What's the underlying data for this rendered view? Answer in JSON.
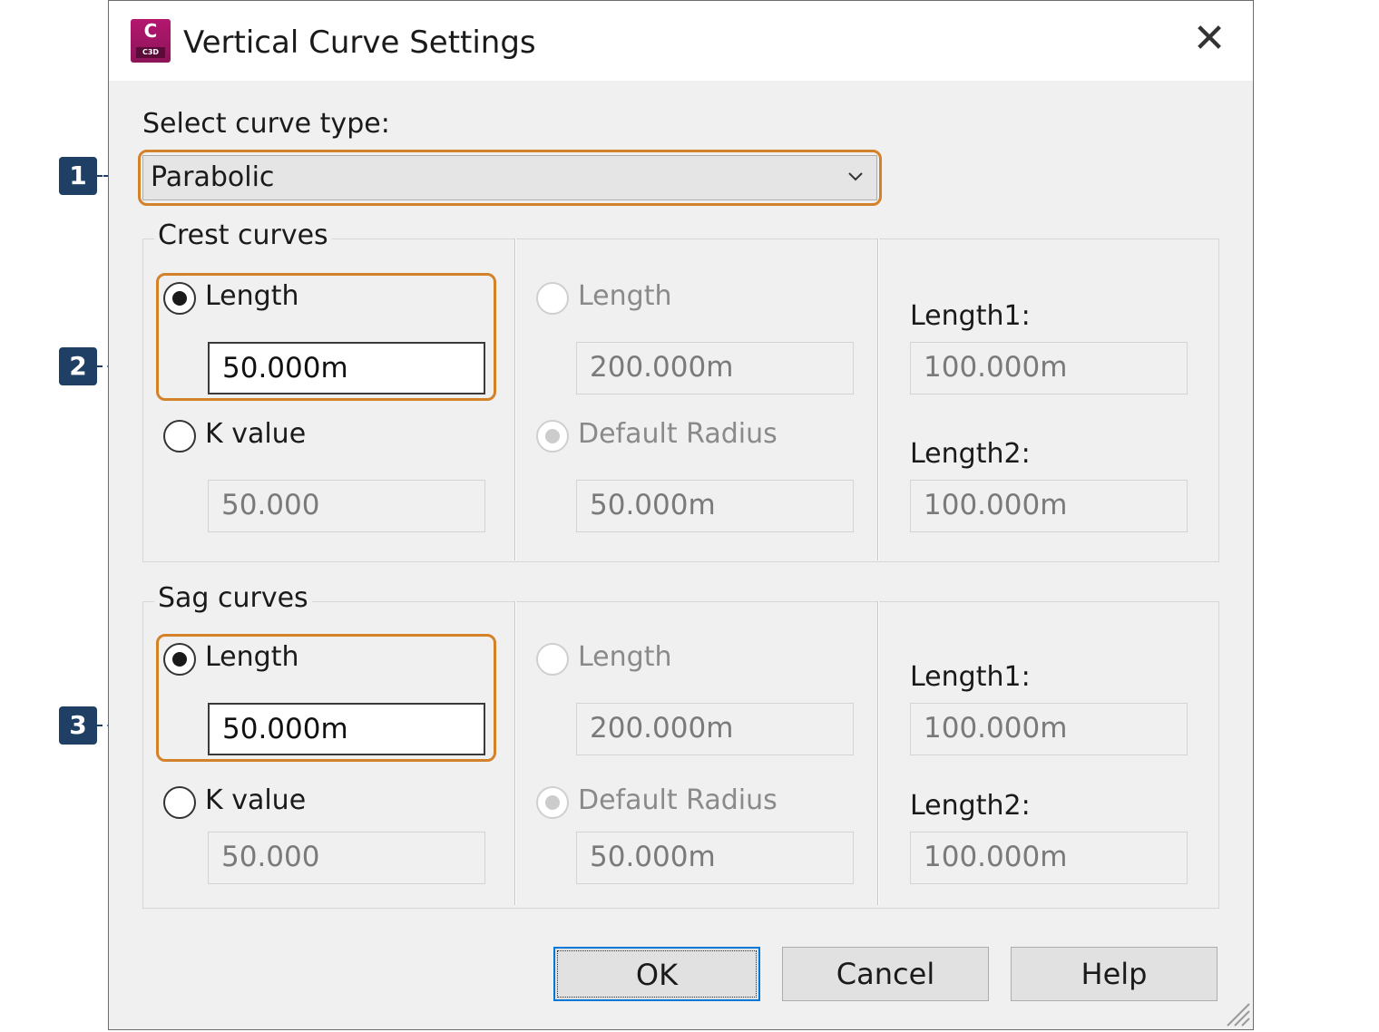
{
  "window": {
    "title": "Vertical Curve Settings",
    "app_icon_letter": "C",
    "app_icon_sub": "C3D",
    "close_glyph": "✕"
  },
  "curve_type": {
    "label": "Select curve type:",
    "value": "Parabolic"
  },
  "crest": {
    "legend": "Crest curves",
    "length_radio": {
      "label": "Length",
      "selected": true
    },
    "length_value": "50.000m",
    "kvalue_radio": {
      "label": "K value",
      "selected": false
    },
    "kvalue_value": "50.000",
    "col2_length_label": "Length",
    "col2_length_value": "200.000m",
    "col2_radius_label": "Default Radius",
    "col2_radius_value": "50.000m",
    "length1_label": "Length1:",
    "length1_value": "100.000m",
    "length2_label": "Length2:",
    "length2_value": "100.000m"
  },
  "sag": {
    "legend": "Sag curves",
    "length_radio": {
      "label": "Length",
      "selected": true
    },
    "length_value": "50.000m",
    "kvalue_radio": {
      "label": "K value",
      "selected": false
    },
    "kvalue_value": "50.000",
    "col2_length_label": "Length",
    "col2_length_value": "200.000m",
    "col2_radius_label": "Default Radius",
    "col2_radius_value": "50.000m",
    "length1_label": "Length1:",
    "length1_value": "100.000m",
    "length2_label": "Length2:",
    "length2_value": "100.000m"
  },
  "buttons": {
    "ok": "OK",
    "cancel": "Cancel",
    "help": "Help"
  },
  "callouts": [
    "1",
    "2",
    "3"
  ],
  "colors": {
    "highlight": "#d4822a",
    "callout": "#1f3f64",
    "focus_border": "#0078d7",
    "app_icon": "#b4176f"
  }
}
